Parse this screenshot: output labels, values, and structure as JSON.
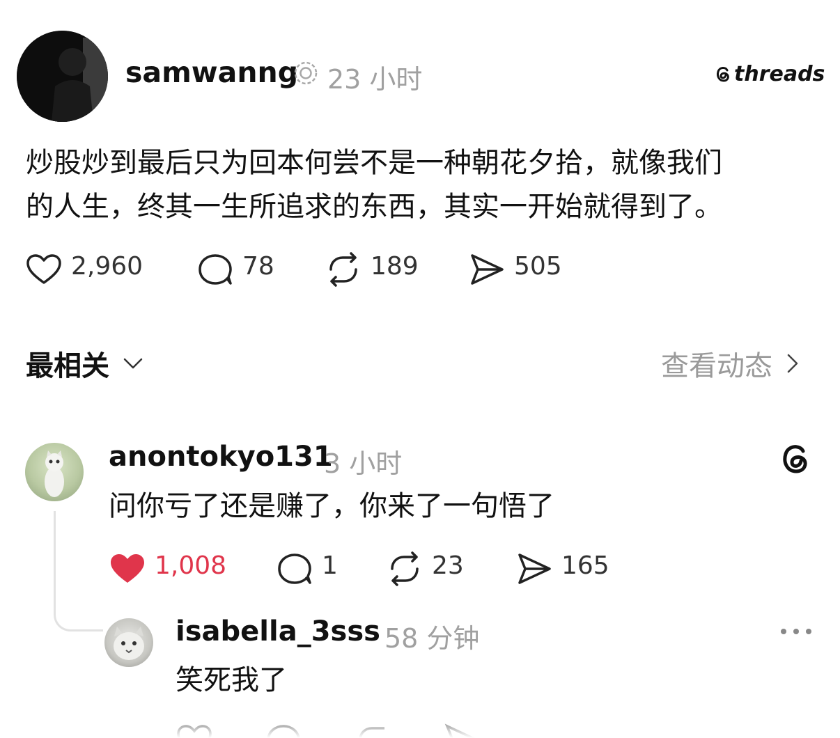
{
  "post": {
    "author": "samwanng",
    "time": "23 小时",
    "brand": "threads",
    "text_line1": "炒股炒到最后只为回本何尝不是一种朝花夕拾，就像我们",
    "text_line2": "的人生，终其一生所追求的东西，其实一开始就得到了。",
    "likes": "2,960",
    "comments": "78",
    "reposts": "189",
    "shares": "505"
  },
  "sort": {
    "label": "最相关",
    "activity": "查看动态"
  },
  "comment1": {
    "author": "anontokyo131",
    "time": "3 小时",
    "text": "问你亏了还是赚了，你来了一句悟了",
    "likes": "1,008",
    "liked": true,
    "comments": "1",
    "reposts": "23",
    "shares": "165"
  },
  "comment2": {
    "author": "isabella_3sss",
    "time": "58 分钟",
    "text": "笑死我了"
  },
  "colors": {
    "like_active": "#e0354b",
    "muted": "#9a9a9a",
    "text": "#111111"
  },
  "icons": [
    "verified-badge-icon",
    "threads-logo-icon",
    "heart-icon",
    "comment-icon",
    "repost-icon",
    "share-icon",
    "chevron-down-icon",
    "chevron-right-icon",
    "more-icon"
  ]
}
